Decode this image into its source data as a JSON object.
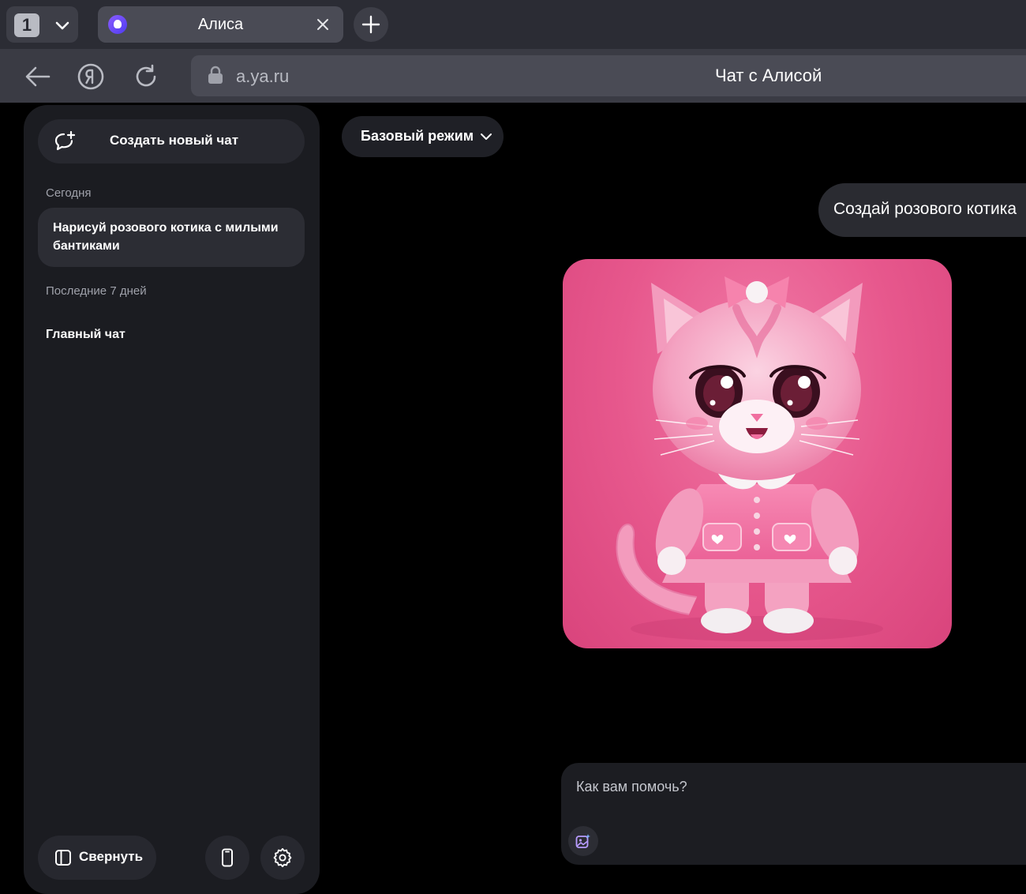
{
  "browser": {
    "tab_count": "1",
    "active_tab": {
      "title": "Алиса"
    },
    "address": {
      "url": "a.ya.ru",
      "page_title": "Чат с Алисой"
    }
  },
  "sidebar": {
    "new_chat_label": "Создать новый чат",
    "sections": [
      {
        "label": "Сегодня",
        "items": [
          {
            "label": "Нарисуй розового котика с милыми бантиками",
            "active": true
          }
        ]
      },
      {
        "label": "Последние 7 дней",
        "items": [
          {
            "label": "Главный чат",
            "active": false
          }
        ]
      }
    ],
    "collapse_label": "Свернуть"
  },
  "main": {
    "mode_label": "Базовый режим",
    "messages": [
      {
        "role": "user",
        "text": "Создай розового котика"
      },
      {
        "role": "assistant",
        "type": "image",
        "depicts": "pink-kitten"
      }
    ],
    "composer": {
      "placeholder": "Как вам помочь?"
    }
  },
  "colors": {
    "page_bg": "#000000",
    "tabstrip_bg": "#2b2c34",
    "toolbar_bg": "#3a3b44",
    "sidebar_bg": "#1b1c21",
    "accent_pink": "#e7588d",
    "alice_purple": "#8a5cff"
  },
  "icons": [
    "chevron-down-icon",
    "close-icon",
    "plus-icon",
    "back-arrow-icon",
    "yandex-icon",
    "reload-icon",
    "lock-icon",
    "new-chat-icon",
    "sidebar-collapse-icon",
    "phone-icon",
    "gear-icon",
    "image-sparkle-icon"
  ]
}
